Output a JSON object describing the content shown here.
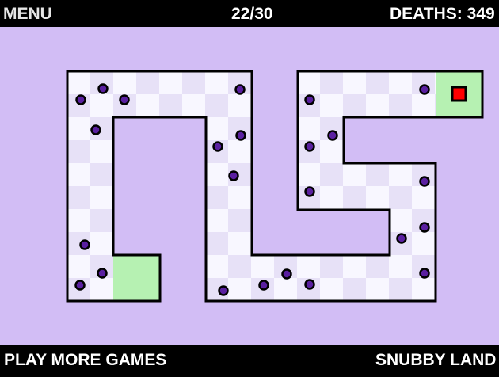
{
  "header": {
    "menu_label": "MENU",
    "level": "22/30",
    "deaths": "DEATHS: 349"
  },
  "footer": {
    "play_more": "PLAY MORE GAMES",
    "brand": "SNUBBY LAND"
  },
  "colors": {
    "background": "#d2bdf5",
    "tile_light": "#f8f7ff",
    "tile_dark": "#e7e1f7",
    "safe_zone": "#b6f1b2",
    "wall": "#000000",
    "enemy_fill": "#5a1fa0",
    "player": "#ff0000"
  },
  "player": {
    "icon": "player-square-icon"
  },
  "enemy": {
    "icon": "enemy-dot-icon"
  }
}
